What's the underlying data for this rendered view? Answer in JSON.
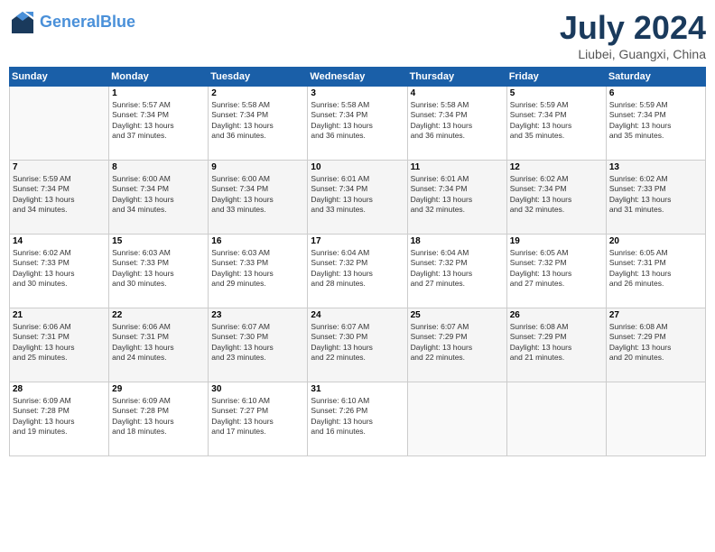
{
  "header": {
    "logo_line1": "General",
    "logo_line2": "Blue",
    "month_year": "July 2024",
    "location": "Liubei, Guangxi, China"
  },
  "weekdays": [
    "Sunday",
    "Monday",
    "Tuesday",
    "Wednesday",
    "Thursday",
    "Friday",
    "Saturday"
  ],
  "weeks": [
    [
      {
        "day": "",
        "content": ""
      },
      {
        "day": "1",
        "content": "Sunrise: 5:57 AM\nSunset: 7:34 PM\nDaylight: 13 hours\nand 37 minutes."
      },
      {
        "day": "2",
        "content": "Sunrise: 5:58 AM\nSunset: 7:34 PM\nDaylight: 13 hours\nand 36 minutes."
      },
      {
        "day": "3",
        "content": "Sunrise: 5:58 AM\nSunset: 7:34 PM\nDaylight: 13 hours\nand 36 minutes."
      },
      {
        "day": "4",
        "content": "Sunrise: 5:58 AM\nSunset: 7:34 PM\nDaylight: 13 hours\nand 36 minutes."
      },
      {
        "day": "5",
        "content": "Sunrise: 5:59 AM\nSunset: 7:34 PM\nDaylight: 13 hours\nand 35 minutes."
      },
      {
        "day": "6",
        "content": "Sunrise: 5:59 AM\nSunset: 7:34 PM\nDaylight: 13 hours\nand 35 minutes."
      }
    ],
    [
      {
        "day": "7",
        "content": "Sunrise: 5:59 AM\nSunset: 7:34 PM\nDaylight: 13 hours\nand 34 minutes."
      },
      {
        "day": "8",
        "content": "Sunrise: 6:00 AM\nSunset: 7:34 PM\nDaylight: 13 hours\nand 34 minutes."
      },
      {
        "day": "9",
        "content": "Sunrise: 6:00 AM\nSunset: 7:34 PM\nDaylight: 13 hours\nand 33 minutes."
      },
      {
        "day": "10",
        "content": "Sunrise: 6:01 AM\nSunset: 7:34 PM\nDaylight: 13 hours\nand 33 minutes."
      },
      {
        "day": "11",
        "content": "Sunrise: 6:01 AM\nSunset: 7:34 PM\nDaylight: 13 hours\nand 32 minutes."
      },
      {
        "day": "12",
        "content": "Sunrise: 6:02 AM\nSunset: 7:34 PM\nDaylight: 13 hours\nand 32 minutes."
      },
      {
        "day": "13",
        "content": "Sunrise: 6:02 AM\nSunset: 7:33 PM\nDaylight: 13 hours\nand 31 minutes."
      }
    ],
    [
      {
        "day": "14",
        "content": "Sunrise: 6:02 AM\nSunset: 7:33 PM\nDaylight: 13 hours\nand 30 minutes."
      },
      {
        "day": "15",
        "content": "Sunrise: 6:03 AM\nSunset: 7:33 PM\nDaylight: 13 hours\nand 30 minutes."
      },
      {
        "day": "16",
        "content": "Sunrise: 6:03 AM\nSunset: 7:33 PM\nDaylight: 13 hours\nand 29 minutes."
      },
      {
        "day": "17",
        "content": "Sunrise: 6:04 AM\nSunset: 7:32 PM\nDaylight: 13 hours\nand 28 minutes."
      },
      {
        "day": "18",
        "content": "Sunrise: 6:04 AM\nSunset: 7:32 PM\nDaylight: 13 hours\nand 27 minutes."
      },
      {
        "day": "19",
        "content": "Sunrise: 6:05 AM\nSunset: 7:32 PM\nDaylight: 13 hours\nand 27 minutes."
      },
      {
        "day": "20",
        "content": "Sunrise: 6:05 AM\nSunset: 7:31 PM\nDaylight: 13 hours\nand 26 minutes."
      }
    ],
    [
      {
        "day": "21",
        "content": "Sunrise: 6:06 AM\nSunset: 7:31 PM\nDaylight: 13 hours\nand 25 minutes."
      },
      {
        "day": "22",
        "content": "Sunrise: 6:06 AM\nSunset: 7:31 PM\nDaylight: 13 hours\nand 24 minutes."
      },
      {
        "day": "23",
        "content": "Sunrise: 6:07 AM\nSunset: 7:30 PM\nDaylight: 13 hours\nand 23 minutes."
      },
      {
        "day": "24",
        "content": "Sunrise: 6:07 AM\nSunset: 7:30 PM\nDaylight: 13 hours\nand 22 minutes."
      },
      {
        "day": "25",
        "content": "Sunrise: 6:07 AM\nSunset: 7:29 PM\nDaylight: 13 hours\nand 22 minutes."
      },
      {
        "day": "26",
        "content": "Sunrise: 6:08 AM\nSunset: 7:29 PM\nDaylight: 13 hours\nand 21 minutes."
      },
      {
        "day": "27",
        "content": "Sunrise: 6:08 AM\nSunset: 7:29 PM\nDaylight: 13 hours\nand 20 minutes."
      }
    ],
    [
      {
        "day": "28",
        "content": "Sunrise: 6:09 AM\nSunset: 7:28 PM\nDaylight: 13 hours\nand 19 minutes."
      },
      {
        "day": "29",
        "content": "Sunrise: 6:09 AM\nSunset: 7:28 PM\nDaylight: 13 hours\nand 18 minutes."
      },
      {
        "day": "30",
        "content": "Sunrise: 6:10 AM\nSunset: 7:27 PM\nDaylight: 13 hours\nand 17 minutes."
      },
      {
        "day": "31",
        "content": "Sunrise: 6:10 AM\nSunset: 7:26 PM\nDaylight: 13 hours\nand 16 minutes."
      },
      {
        "day": "",
        "content": ""
      },
      {
        "day": "",
        "content": ""
      },
      {
        "day": "",
        "content": ""
      }
    ]
  ]
}
